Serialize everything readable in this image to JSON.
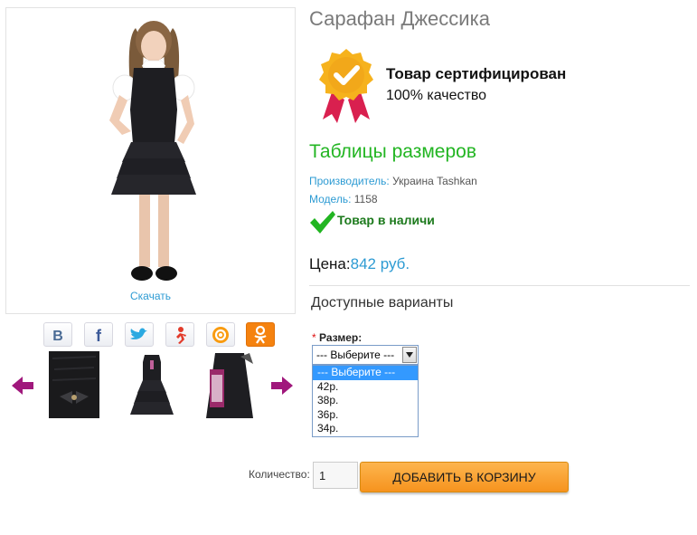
{
  "product": {
    "title": "Сарафан Джессика",
    "download_label": "Скачать",
    "certificate": {
      "title": "Товар сертифицирован",
      "subtitle": "100% качество"
    },
    "size_table_link": "Таблицы размеров",
    "manufacturer": {
      "label": "Производитель:",
      "value": " Украина Tashkan"
    },
    "model": {
      "label": "Модель:",
      "value": " 1158"
    },
    "stock_status": "Товар в наличи",
    "price": {
      "label": "Цена:",
      "value": "842 руб."
    }
  },
  "social": [
    "vkontakte-icon",
    "facebook-icon",
    "twitter-icon",
    "odnoklassniki-run-icon",
    "mail-ru-icon",
    "odnoklassniki-icon"
  ],
  "colors": {
    "accent_blue": "#2d9bd3",
    "green": "#22b522",
    "orange": "#f6931e"
  },
  "options": {
    "section_title": "Доступные варианты",
    "required_mark": "*",
    "size_label": "Размер:",
    "size_selected": "--- Выберите ---",
    "size_options": [
      "--- Выберите ---",
      "42р.",
      "38р.",
      "36р.",
      "34р."
    ]
  },
  "cart": {
    "quantity_label": "Количество:",
    "quantity_value": "1",
    "add_button": "ДОБАВИТЬ В КОРЗИНУ"
  }
}
